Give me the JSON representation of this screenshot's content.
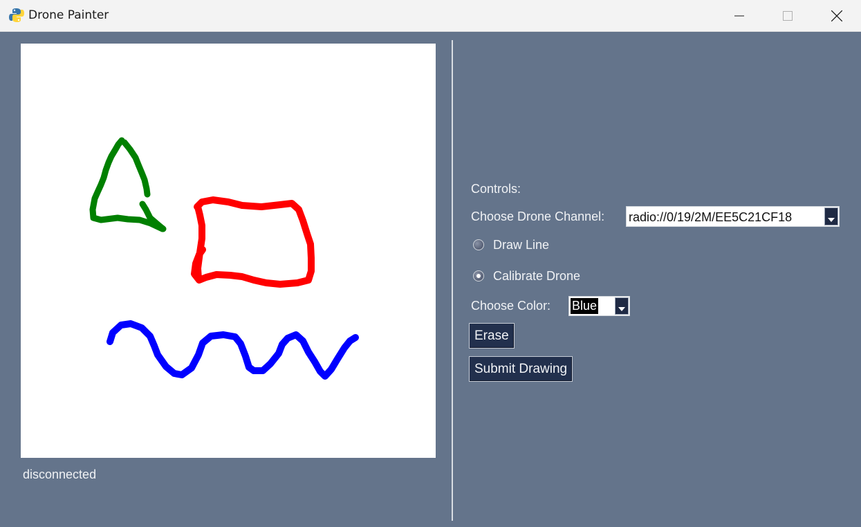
{
  "window": {
    "title": "Drone Painter",
    "app_icon": "python-icon",
    "controls": {
      "minimize": "minimize-icon",
      "maximize": "maximize-icon",
      "close": "close-icon"
    }
  },
  "canvas": {
    "background": "#ffffff",
    "strokes": [
      {
        "color": "#008000",
        "name": "green-triangle-stroke"
      },
      {
        "color": "#ff0000",
        "name": "red-rectangle-stroke"
      },
      {
        "color": "#0000ff",
        "name": "blue-wave-stroke"
      }
    ]
  },
  "status": {
    "text": "disconnected"
  },
  "controls": {
    "heading": "Controls:",
    "channel_label": "Choose Drone Channel:",
    "channel_value": "radio://0/19/2M/EE5C21CF18",
    "modes": [
      {
        "label": "Draw Line",
        "checked": false
      },
      {
        "label": "Calibrate Drone",
        "checked": true
      }
    ],
    "color_label": "Choose Color:",
    "color_value": "Blue",
    "erase_label": "Erase",
    "submit_label": "Submit Drawing"
  },
  "colors": {
    "background": "#64748b",
    "button": "#22304d",
    "titlebar": "#f3f3f3"
  }
}
